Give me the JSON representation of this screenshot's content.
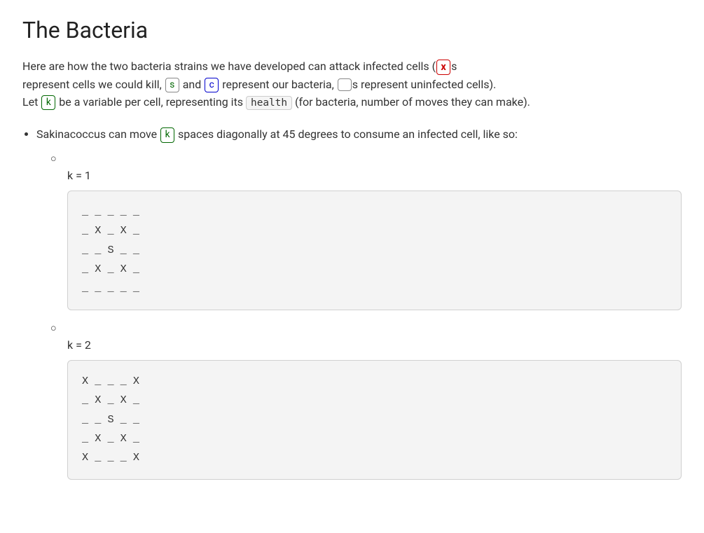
{
  "page": {
    "title": "The Bacteria",
    "intro_line1": "Here are how the two bacteria strains we have developed can attack infected cells (",
    "intro_x": "x",
    "intro_line1b": "s",
    "intro_line2a": "represent cells we could kill,",
    "intro_s": "s",
    "intro_and": "and",
    "intro_c": "c",
    "intro_line2b": "represent our bacteria,",
    "intro_empty": "",
    "intro_line2c": "s represent uninfected cells).",
    "intro_line3a": "Let",
    "intro_k": "k",
    "intro_line3b": "be a variable per cell, representing its",
    "intro_health": "health",
    "intro_line3c": "(for bacteria, number of moves they can make).",
    "bullet1_text": "Sakinacoccus can move",
    "bullet1_k": "k",
    "bullet1_text2": "spaces diagonally at 45 degrees to consume an infected cell, like so:",
    "k1_label": "k = 1",
    "k1_grid": "_ _ _ _ _\n_ X _ X _\n_ _ S _ _\n_ X _ X _\n_ _ _ _ _",
    "k2_label": "k = 2",
    "k2_grid": "X _ _ _ X\n_ X _ X _\n_ _ S _ _\n_ X _ X _\nX _ _ _ X"
  }
}
